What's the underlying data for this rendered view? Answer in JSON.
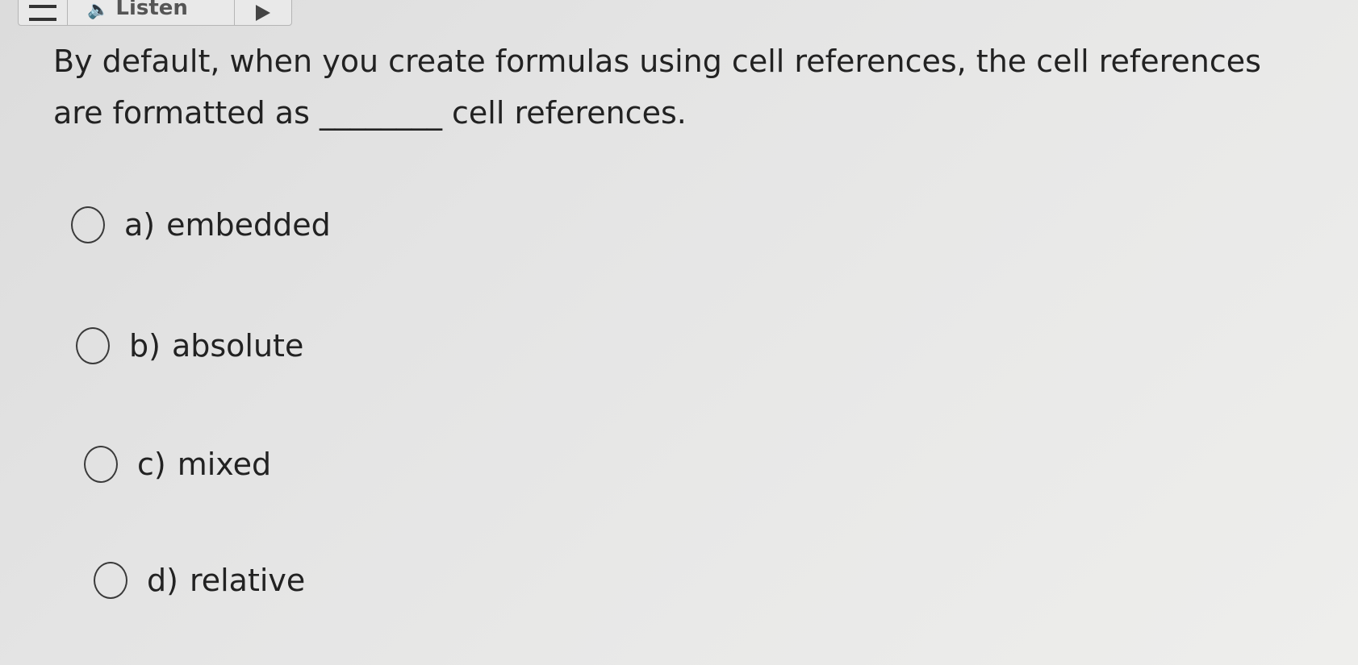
{
  "toolbar": {
    "menu_icon": "hamburger-icon",
    "listen_icon": "speaker-icon",
    "listen_label": "Listen",
    "play_icon": "play-icon"
  },
  "question": {
    "text": "By default, when you create formulas using cell references, the cell references are formatted as ________ cell references."
  },
  "options": [
    {
      "letter": "a)",
      "text": "embedded"
    },
    {
      "letter": "b)",
      "text": "absolute"
    },
    {
      "letter": "c)",
      "text": "mixed"
    },
    {
      "letter": "d)",
      "text": "relative"
    }
  ],
  "colors": {
    "text": "#222222",
    "radio_border": "#3a3a3a",
    "background": "#e6e6e5"
  }
}
